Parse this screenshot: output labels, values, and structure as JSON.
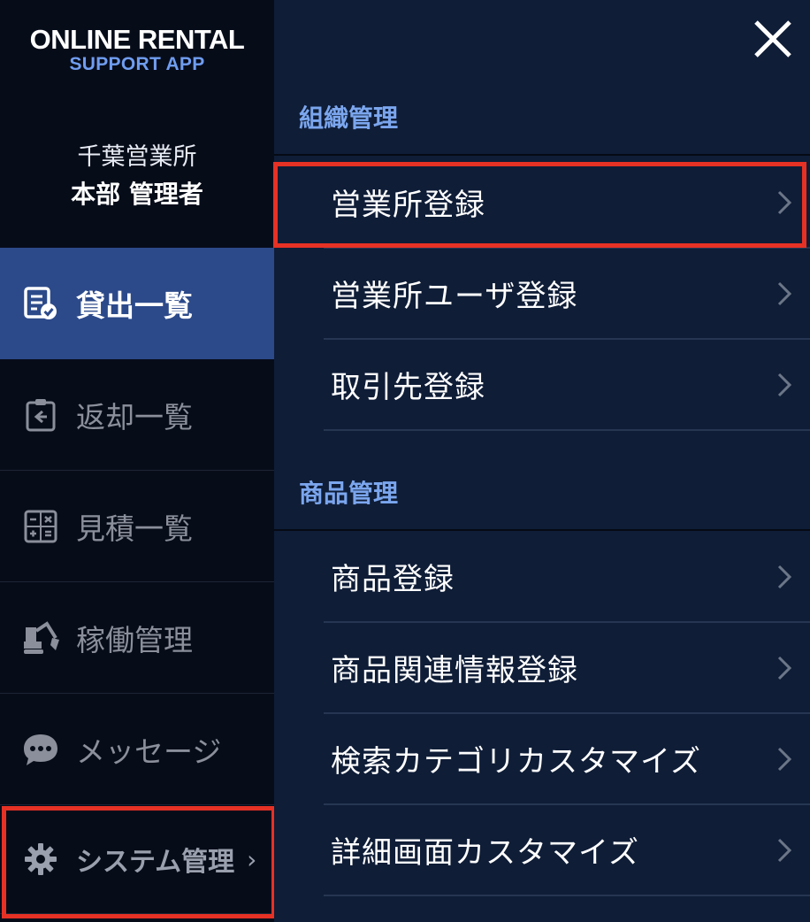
{
  "logo": {
    "main": "ONLINE RENTAL",
    "sub": "SUPPORT APP"
  },
  "office": {
    "name": "千葉営業所",
    "role": "本部 管理者"
  },
  "nav": [
    {
      "label": "貸出一覧",
      "icon": "checklist-icon",
      "active": true
    },
    {
      "label": "返却一覧",
      "icon": "return-clipboard-icon",
      "active": false
    },
    {
      "label": "見積一覧",
      "icon": "calculator-icon",
      "active": false
    },
    {
      "label": "稼働管理",
      "icon": "excavator-icon",
      "active": false
    },
    {
      "label": "メッセージ",
      "icon": "chat-bubble-icon",
      "active": false
    },
    {
      "label": "システム管理",
      "icon": "gear-icon",
      "active": false,
      "chevron": "›"
    }
  ],
  "panel": {
    "close_icon": "close-icon",
    "sections": [
      {
        "title": "組織管理",
        "items": [
          "営業所登録",
          "営業所ユーザ登録",
          "取引先登録"
        ]
      },
      {
        "title": "商品管理",
        "items": [
          "商品登録",
          "商品関連情報登録",
          "検索カテゴリカスタマイズ",
          "詳細画面カスタマイズ"
        ]
      }
    ]
  },
  "colors": {
    "sidebar_bg": "#070c19",
    "panel_bg": "#0f1d37",
    "active_bg": "#2c4a8a",
    "section_title": "#7ba6ee",
    "highlight": "#e63125"
  }
}
